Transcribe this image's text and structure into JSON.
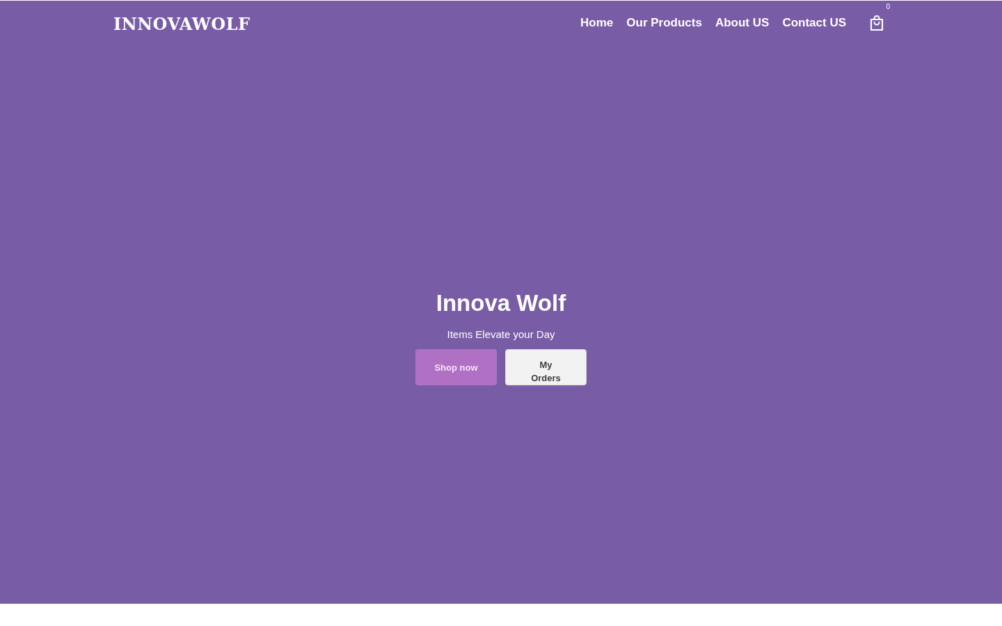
{
  "header": {
    "logo": "INNOVAWOLF",
    "nav": [
      "Home",
      "Our Products",
      "About US",
      "Contact US"
    ],
    "cart": {
      "count": "0"
    }
  },
  "hero": {
    "title": "Innova Wolf",
    "subtitle": "Items Elevate your Day",
    "buttons": [
      {
        "label": "Shop now",
        "kind": "primary"
      },
      {
        "label": "My Orders",
        "kind": "secondary"
      }
    ]
  }
}
